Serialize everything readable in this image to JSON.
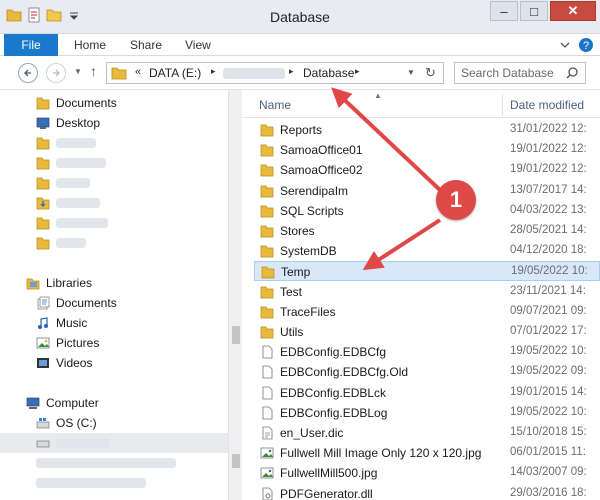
{
  "window": {
    "title": "Database",
    "minimize": "–",
    "maximize": "□",
    "close": "✕"
  },
  "ribbon": {
    "tabs": [
      "File",
      "Home",
      "Share",
      "View"
    ],
    "help": "?"
  },
  "address": {
    "prefix": "«",
    "drive": "DATA (E:)",
    "current": "Database",
    "sep": "▸"
  },
  "search": {
    "placeholder": "Search Database"
  },
  "navpane": {
    "quick_access": [
      "Documents",
      "Desktop"
    ],
    "libraries_label": "Libraries",
    "libraries": [
      "Documents",
      "Music",
      "Pictures",
      "Videos"
    ],
    "computer_label": "Computer",
    "drives": [
      "OS (C:)"
    ]
  },
  "columns": {
    "name": "Name",
    "date": "Date modified"
  },
  "files": [
    {
      "name": "Reports",
      "date": "31/01/2022 12:",
      "kind": "folder"
    },
    {
      "name": "SamoaOffice01",
      "date": "19/01/2022 12:",
      "kind": "folder"
    },
    {
      "name": "SamoaOffice02",
      "date": "19/01/2022 12:",
      "kind": "folder"
    },
    {
      "name": "SerendipaIm",
      "date": "13/07/2017 14:",
      "kind": "folder"
    },
    {
      "name": "SQL Scripts",
      "date": "04/03/2022 13:",
      "kind": "folder"
    },
    {
      "name": "Stores",
      "date": "28/05/2021 14:",
      "kind": "folder"
    },
    {
      "name": "SystemDB",
      "date": "04/12/2020 18:",
      "kind": "folder"
    },
    {
      "name": "Temp",
      "date": "19/05/2022 10:",
      "kind": "folder"
    },
    {
      "name": "Test",
      "date": "23/11/2021 14:",
      "kind": "folder"
    },
    {
      "name": "TraceFiles",
      "date": "09/07/2021 09:",
      "kind": "folder"
    },
    {
      "name": "Utils",
      "date": "07/01/2022 17:",
      "kind": "folder"
    },
    {
      "name": "EDBConfig.EDBCfg",
      "date": "19/05/2022 10:",
      "kind": "file"
    },
    {
      "name": "EDBConfig.EDBCfg.Old",
      "date": "19/05/2022 09:",
      "kind": "file"
    },
    {
      "name": "EDBConfig.EDBLck",
      "date": "19/01/2015 14:",
      "kind": "file"
    },
    {
      "name": "EDBConfig.EDBLog",
      "date": "19/05/2022 10:",
      "kind": "file"
    },
    {
      "name": "en_User.dic",
      "date": "15/10/2018 15:",
      "kind": "dic"
    },
    {
      "name": "Fullwell Mill Image Only 120 x 120.jpg",
      "date": "06/01/2015 11:",
      "kind": "image"
    },
    {
      "name": "FullwellMill500.jpg",
      "date": "14/03/2007 09:",
      "kind": "image"
    },
    {
      "name": "PDFGenerator.dll",
      "date": "29/03/2016 18:",
      "kind": "dll"
    }
  ],
  "annotation": {
    "badge": "1",
    "color": "#e04848"
  }
}
